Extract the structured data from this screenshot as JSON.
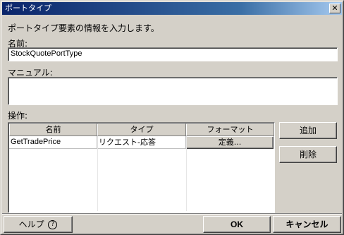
{
  "window": {
    "title": "ポートタイプ",
    "close_glyph": "✕"
  },
  "instruction": "ポートタイプ要素の情報を入力します。",
  "name_field": {
    "label": "名前:",
    "value": "StockQuotePortType"
  },
  "manual_field": {
    "label": "マニュアル:",
    "value": ""
  },
  "operations": {
    "label": "操作:",
    "columns": [
      "名前",
      "タイプ",
      "フォーマット"
    ],
    "rows": [
      {
        "name": "GetTradePrice",
        "type": "リクエスト-応答",
        "format_button": "定義..."
      }
    ]
  },
  "side_buttons": {
    "add": "追加",
    "delete": "削除"
  },
  "footer": {
    "help": "ヘルプ",
    "help_icon": "?",
    "ok": "OK",
    "cancel": "キャンセル"
  }
}
